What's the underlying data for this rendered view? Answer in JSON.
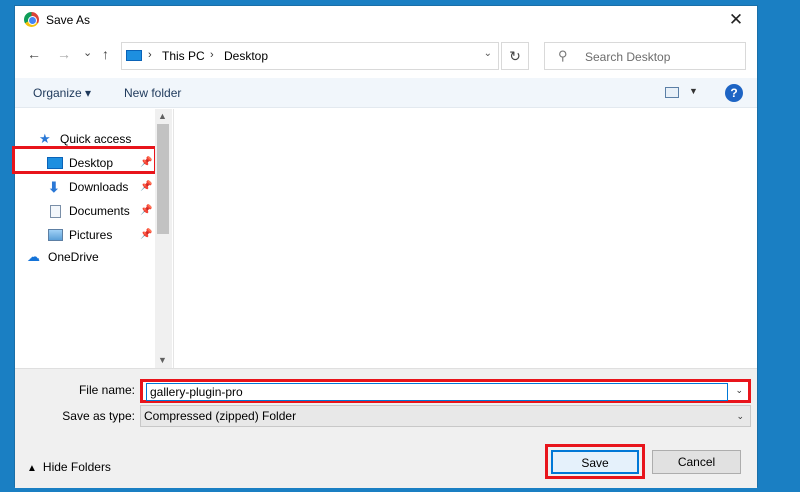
{
  "window": {
    "title": "Save As",
    "close": "✕"
  },
  "nav": {
    "back": "←",
    "forward": "→",
    "recent": "⌄",
    "up": "↑",
    "path": [
      "This PC",
      "Desktop"
    ],
    "separator": "›",
    "refresh": "↻",
    "search_placeholder": "Search Desktop"
  },
  "toolbar": {
    "organize": "Organize ▾",
    "new_folder": "New folder",
    "help": "?"
  },
  "tree": [
    {
      "label": "Quick access",
      "icon": "star-icon"
    },
    {
      "label": "Desktop",
      "icon": "desktop-icon",
      "pinned": true
    },
    {
      "label": "Downloads",
      "icon": "download-icon",
      "pinned": true
    },
    {
      "label": "Documents",
      "icon": "document-icon",
      "pinned": true
    },
    {
      "label": "Pictures",
      "icon": "picture-icon",
      "pinned": true
    },
    {
      "label": "OneDrive",
      "icon": "cloud-icon"
    }
  ],
  "form": {
    "file_name_label": "File name:",
    "file_name_value": "gallery-plugin-pro",
    "save_type_label": "Save as type:",
    "save_type_value": "Compressed (zipped) Folder"
  },
  "buttons": {
    "hide_folders": "Hide Folders",
    "save": "Save",
    "cancel": "Cancel"
  },
  "colors": {
    "accent": "#0078d7",
    "highlight": "#e8141b",
    "desktop_bg": "#1a7fc3"
  }
}
